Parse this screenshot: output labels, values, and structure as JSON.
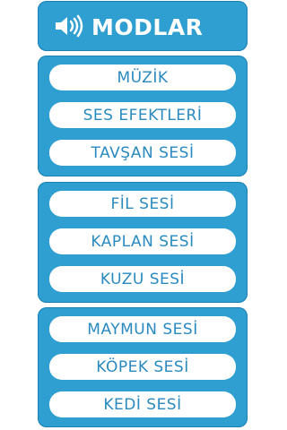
{
  "header": {
    "title": "MODLAR",
    "icon": "speaker-icon"
  },
  "groups": [
    {
      "buttons": [
        {
          "label": "MÜZİK"
        },
        {
          "label": "SES EFEKTLERİ"
        },
        {
          "label": "TAVŞAN SESİ"
        }
      ]
    },
    {
      "buttons": [
        {
          "label": "FİL SESİ"
        },
        {
          "label": "KAPLAN SESİ"
        },
        {
          "label": "KUZU SESİ"
        }
      ]
    },
    {
      "buttons": [
        {
          "label": "MAYMUN SESİ"
        },
        {
          "label": "KÖPEK SESİ"
        },
        {
          "label": "KEDİ SESİ"
        }
      ]
    }
  ],
  "colors": {
    "panel": "#2f9fd2",
    "panel_border": "#1b7fb2",
    "button_bg": "#ffffff",
    "button_text": "#2a8ac0",
    "header_text": "#ffffff"
  }
}
